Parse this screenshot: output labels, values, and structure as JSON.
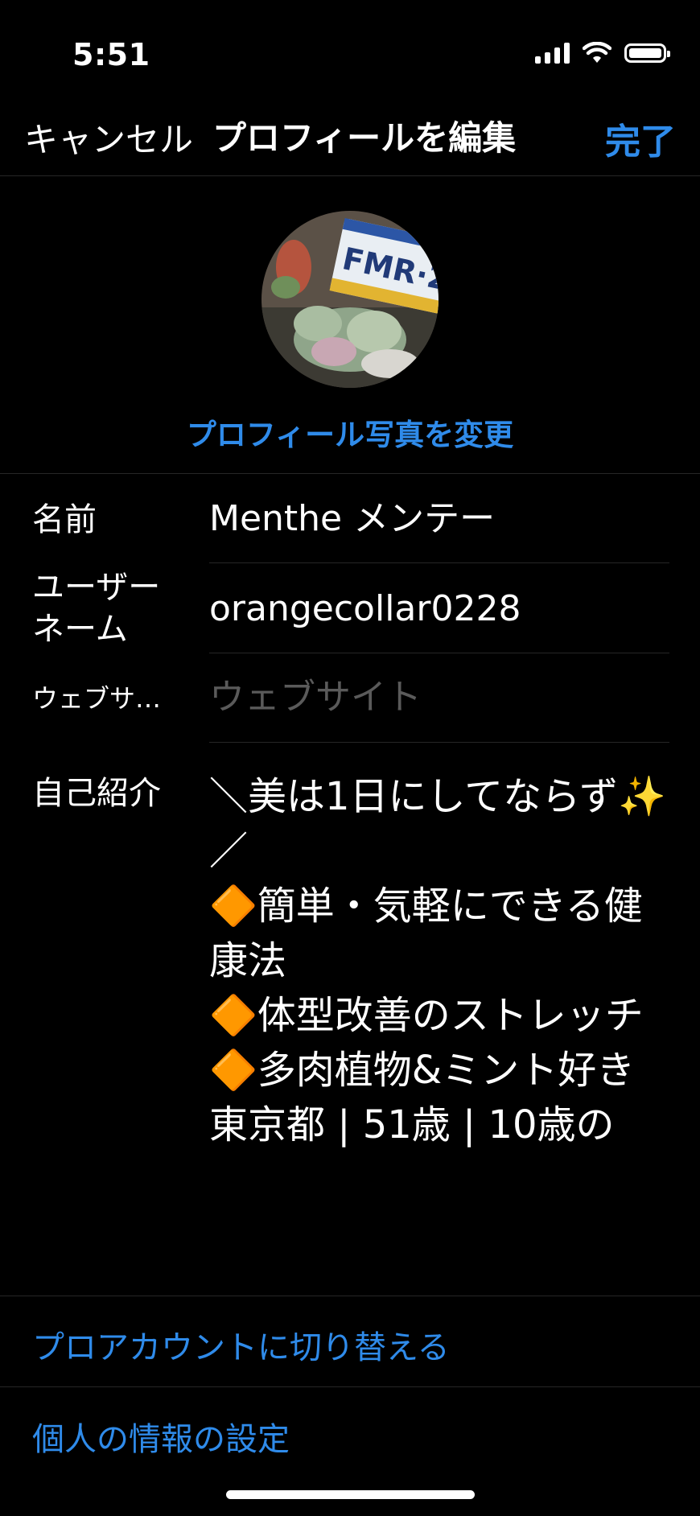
{
  "status_bar": {
    "time": "5:51"
  },
  "nav": {
    "cancel_label": "キャンセル",
    "title": "プロフィールを編集",
    "done_label": "完了"
  },
  "profile": {
    "change_photo_label": "プロフィール写真を変更"
  },
  "form": {
    "name": {
      "label": "名前",
      "value": "Menthe メンテー"
    },
    "username": {
      "label": "ユーザー\nネーム",
      "value": "orangecollar0228"
    },
    "website": {
      "label": "ウェブサ…",
      "placeholder": "ウェブサイト"
    },
    "bio": {
      "label": "自己紹介",
      "value": "＼美は1日にしてならず✨／\n🔶簡単・気軽にできる健康法\n🔶体型改善のストレッチ\n🔶多肉植物&ミント好き\n東京都 | 51歳 | 10歳の"
    }
  },
  "links": {
    "switch_pro": "プロアカウントに切り替える",
    "personal_info": "個人の情報の設定"
  },
  "colors": {
    "accent": "#2f8bea",
    "background": "#000000",
    "divider": "#262626"
  }
}
